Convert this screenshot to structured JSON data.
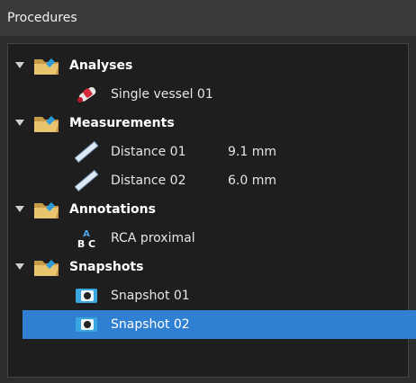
{
  "panel": {
    "title": "Procedures"
  },
  "groups": [
    {
      "label": "Analyses",
      "items": [
        {
          "label": "Single vessel 01",
          "value": "",
          "icon": "vessel-icon"
        }
      ]
    },
    {
      "label": "Measurements",
      "items": [
        {
          "label": "Distance 01",
          "value": "9.1 mm",
          "icon": "ruler-icon"
        },
        {
          "label": "Distance 02",
          "value": "6.0 mm",
          "icon": "ruler-icon"
        }
      ]
    },
    {
      "label": "Annotations",
      "items": [
        {
          "label": "RCA proximal",
          "value": "",
          "icon": "abc-text-icon"
        }
      ]
    },
    {
      "label": "Snapshots",
      "items": [
        {
          "label": "Snapshot 01",
          "value": "",
          "icon": "camera-icon"
        },
        {
          "label": "Snapshot 02",
          "value": "",
          "icon": "camera-icon",
          "selected": true
        }
      ]
    }
  ],
  "icons": {
    "abc_top": "A",
    "abc_bottom": "B C"
  },
  "colors": {
    "selection": "#2f7fd2",
    "folder": "#d9b15c",
    "folder_badge": "#2d9bd8"
  }
}
